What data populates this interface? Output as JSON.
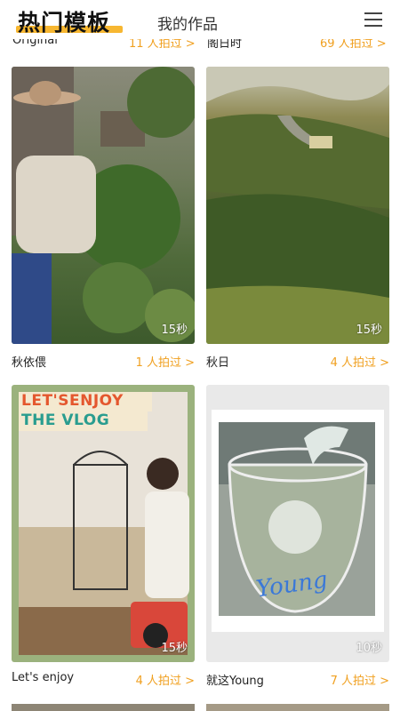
{
  "header": {
    "active_tab": "热门模板",
    "inactive_tab": "我的作品",
    "menu_icon": "hamburger-menu-icon"
  },
  "partial_row": {
    "left_title": "Original",
    "left_count": "11 人拍过 >",
    "right_title": "阁日时",
    "right_count": "69 人拍过 >"
  },
  "cards": [
    {
      "title": "秋依偎",
      "count": "1 人拍过 >",
      "duration": "15秒"
    },
    {
      "title": "秋日",
      "count": "4 人拍过 >",
      "duration": "15秒"
    },
    {
      "title": "Let's enjoy",
      "count": "4 人拍过 >",
      "duration": "15秒",
      "overlay_line1": "LET'SENJOY",
      "overlay_line2": "THE VLOG"
    },
    {
      "title": "就这Young",
      "count": "7 人拍过 >",
      "duration": "10秒",
      "overlay_text": "Young"
    }
  ],
  "colors": {
    "accent": "#f0a020",
    "underline": "#f7b731"
  }
}
